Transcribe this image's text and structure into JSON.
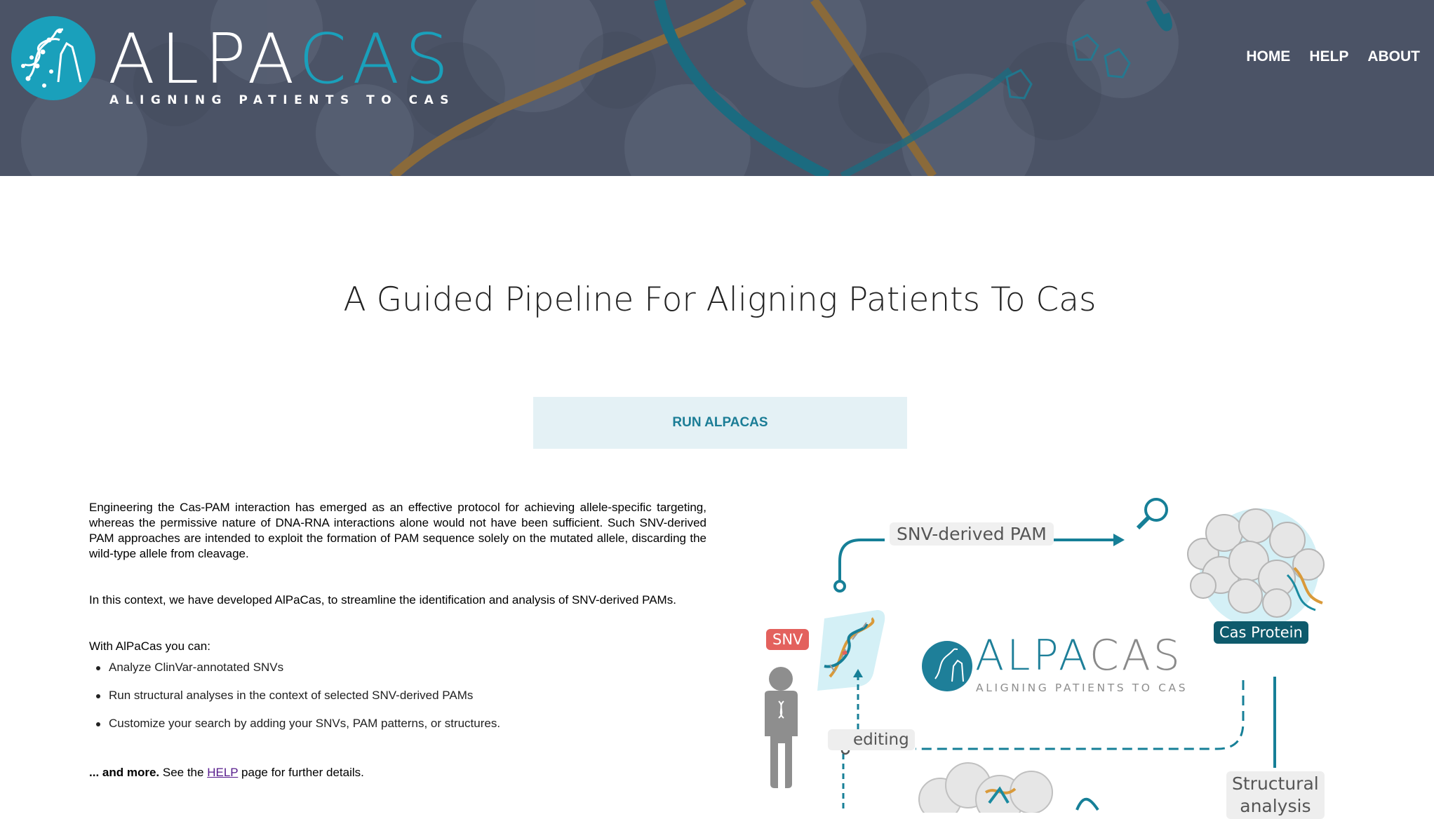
{
  "brand": {
    "name_part1": "ALPA",
    "name_part2": "CAS",
    "tagline": "ALIGNING PATIENTS TO CAS"
  },
  "nav": {
    "items": [
      {
        "label": "HOME"
      },
      {
        "label": "HELP"
      },
      {
        "label": "ABOUT"
      }
    ]
  },
  "main": {
    "title": "A Guided Pipeline For Aligning Patients To Cas",
    "run_button": "RUN ALPACAS",
    "intro": "Engineering the Cas-PAM interaction has emerged as an effective protocol for achieving allele-specific targeting, whereas the permissive nature of DNA-RNA interactions alone would not have been sufficient. Such SNV-derived PAM approaches are intended to exploit the formation of PAM sequence solely on the mutated allele, discarding the wild-type allele from cleavage.",
    "context": "In this context, we have developed AlPaCas, to streamline the identification and analysis of SNV-derived PAMs.",
    "list_lead": "With AlPaCas you can:",
    "features": [
      "Analyze ClinVar-annotated SNVs",
      "Run structural analyses in the context of selected SNV-derived PAMs",
      "Customize your search by adding your SNVs, PAM patterns, or structures."
    ],
    "more_bold": "... and more.",
    "more_pre": " See the ",
    "more_link": "HELP",
    "more_post": " page for further details."
  },
  "diagram": {
    "snv_pam_label": "SNV-derived PAM",
    "snv_label": "SNV",
    "cas_label": "Cas Protein",
    "editing_label": "editing",
    "structural_label_1": "Structural",
    "structural_label_2": "analysis",
    "logo_part1": "ALPA",
    "logo_part2": "CAS",
    "logo_tag": "ALIGNING PATIENTS TO CAS"
  },
  "colors": {
    "header_bg": "#4a5262",
    "accent": "#1aa0bb",
    "button_bg": "#e4f1f5",
    "button_text": "#1b7d96",
    "snv_red": "#e3615d",
    "cas_dark": "#0e5a6c"
  }
}
